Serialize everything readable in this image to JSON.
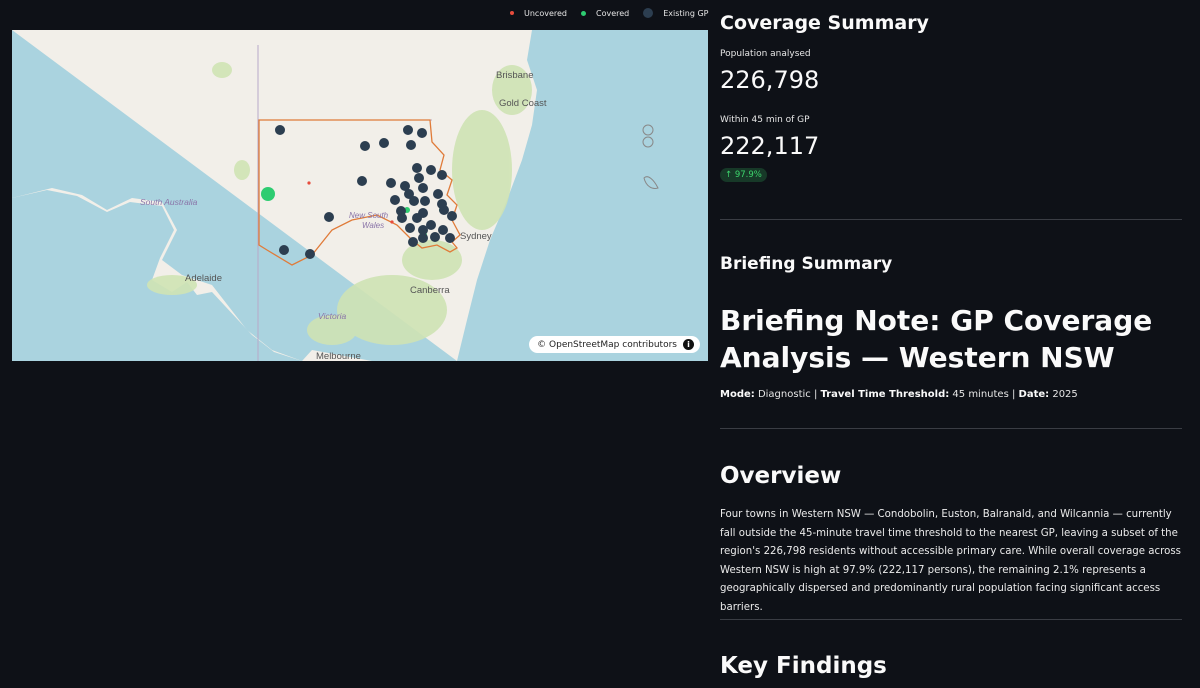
{
  "legend": {
    "uncovered": "Uncovered",
    "covered": "Covered",
    "existing_gp": "Existing GP",
    "colors": {
      "uncovered": "#e74c3c",
      "covered": "#2ecc71",
      "existing_gp": "#2c3e50"
    }
  },
  "map": {
    "place_labels": {
      "brisbane": "Brisbane",
      "gold_coast": "Gold Coast",
      "south_australia": "South Australia",
      "new_south_wales_1": "New South",
      "new_south_wales_2": "Wales",
      "sydney": "Sydney",
      "adelaide": "Adelaide",
      "canberra": "Canberra",
      "victoria": "Victoria",
      "melbourne": "Melbourne"
    },
    "attribution": "© OpenStreetMap contributors",
    "info_glyph": "i"
  },
  "summary": {
    "title": "Coverage Summary",
    "population_label": "Population analysed",
    "population_value": "226,798",
    "within_label": "Within 45 min of GP",
    "within_value": "222,117",
    "delta": "↑ 97.9%"
  },
  "briefing": {
    "section_title": "Briefing Summary",
    "note_title": "Briefing Note: GP Coverage Analysis — Western NSW",
    "mode_label": "Mode:",
    "mode_value": " Diagnostic | ",
    "threshold_label": "Travel Time Threshold:",
    "threshold_value": " 45 minutes | ",
    "date_label": "Date:",
    "date_value": " 2025",
    "overview_title": "Overview",
    "overview_text": "Four towns in Western NSW — Condobolin, Euston, Balranald, and Wilcannia — currently fall outside the 45-minute travel time threshold to the nearest GP, leaving a subset of the region's 226,798 residents without accessible primary care. While overall coverage across Western NSW is high at 97.9% (222,117 persons), the remaining 2.1% represents a geographically dispersed and predominantly rural population facing significant access barriers.",
    "key_findings_title": "Key Findings"
  }
}
